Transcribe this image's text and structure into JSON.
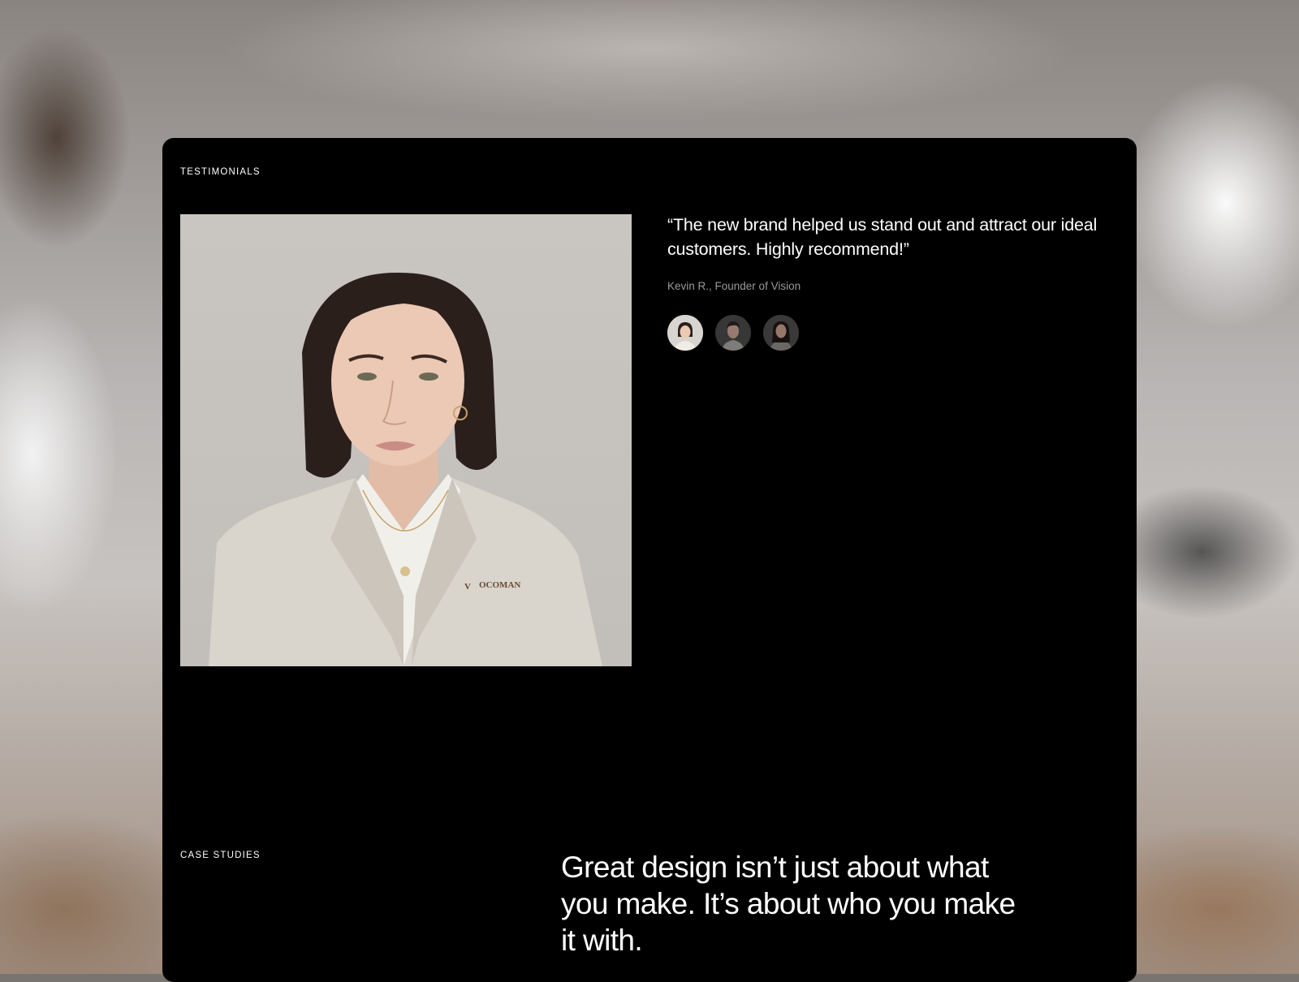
{
  "testimonials": {
    "section_label": "TESTIMONIALS",
    "quote": "“The new brand helped us stand out and attract our ideal customers. Highly recommend!”",
    "author": "Kevin R., Founder of Vision",
    "photo_brand_text": "OCOMAN",
    "avatars": [
      {
        "name": "avatar-woman-light",
        "active": true
      },
      {
        "name": "avatar-man",
        "active": false
      },
      {
        "name": "avatar-woman-dark",
        "active": false
      }
    ]
  },
  "case_studies": {
    "section_label": "CASE STUDIES",
    "headline": "Great design isn’t just about what\nyou make. It’s about who you make\nit with."
  },
  "colors": {
    "card_background": "#000000",
    "text_primary": "#ffffff",
    "text_secondary": "#9a9a9a"
  }
}
